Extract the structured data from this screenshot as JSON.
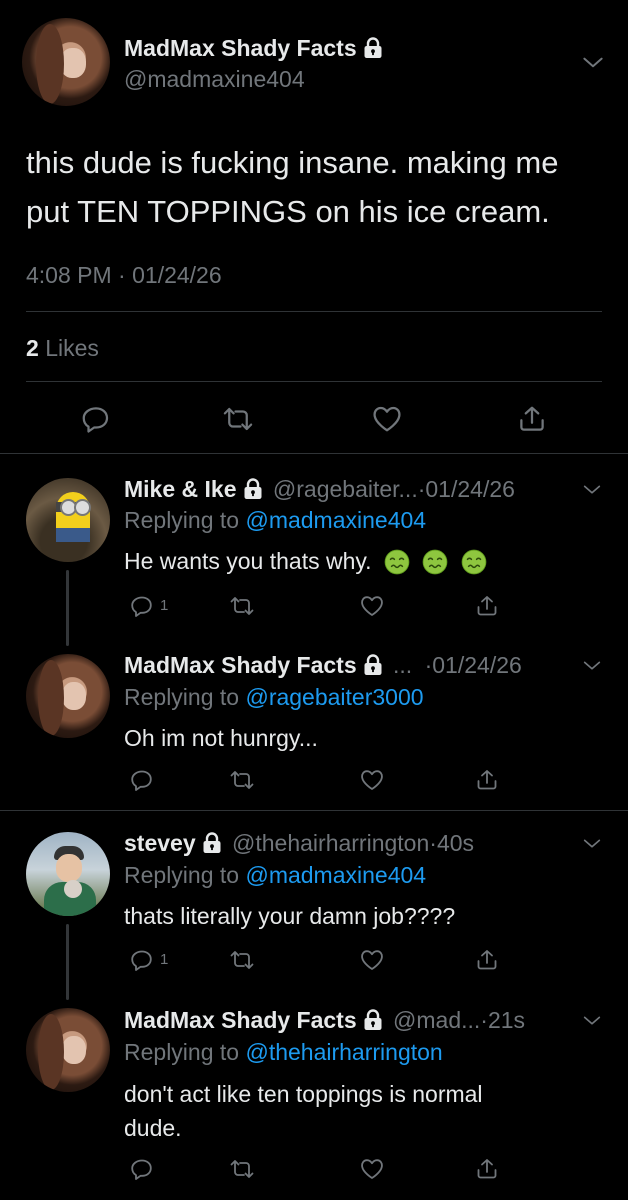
{
  "main_tweet": {
    "display_name": "MadMax Shady Facts",
    "handle": "@madmaxine404",
    "text_line1": "this dude is fucking insane. making me",
    "text_line2": "put TEN TOPPINGS on his ice cream.",
    "time": "4:08 PM",
    "separator": "·",
    "date": "01/24/26",
    "likes_count": "2",
    "likes_label": "Likes"
  },
  "replies": [
    {
      "display_name": "Mike & Ike",
      "handle": "@ragebaiter...",
      "separator": "·",
      "time": "01/24/26",
      "replying_prefix": "Replying to",
      "replying_to": "@madmaxine404",
      "text": "He wants you thats why.",
      "emojis": [
        "nauseated-face",
        "nauseated-face",
        "nauseated-face"
      ],
      "reply_count": "1"
    },
    {
      "display_name": "MadMax Shady Facts",
      "handle": "...",
      "separator": "·",
      "time": "01/24/26",
      "replying_prefix": "Replying to",
      "replying_to": "@ragebaiter3000",
      "text": "Oh im not hunrgy..."
    },
    {
      "display_name": "stevey",
      "handle": "@thehairharrington",
      "separator": "·",
      "time": "40s",
      "replying_prefix": "Replying to",
      "replying_to": "@madmaxine404",
      "text": "thats literally your damn job????",
      "reply_count": "1"
    },
    {
      "display_name": "MadMax Shady Facts",
      "handle": "@mad...",
      "separator": "·",
      "time": "21s",
      "replying_prefix": "Replying to",
      "replying_to": "@thehairharrington",
      "text_line1": "don't act like ten toppings is normal",
      "text_line2": "dude."
    }
  ],
  "colors": {
    "background": "#000000",
    "text": "#e7e9ea",
    "muted": "#71767b",
    "link": "#1d9bf0",
    "divider": "#2f3336"
  },
  "icons": [
    "lock-icon",
    "chevron-down-icon",
    "reply-icon",
    "retweet-icon",
    "like-icon",
    "share-icon"
  ]
}
